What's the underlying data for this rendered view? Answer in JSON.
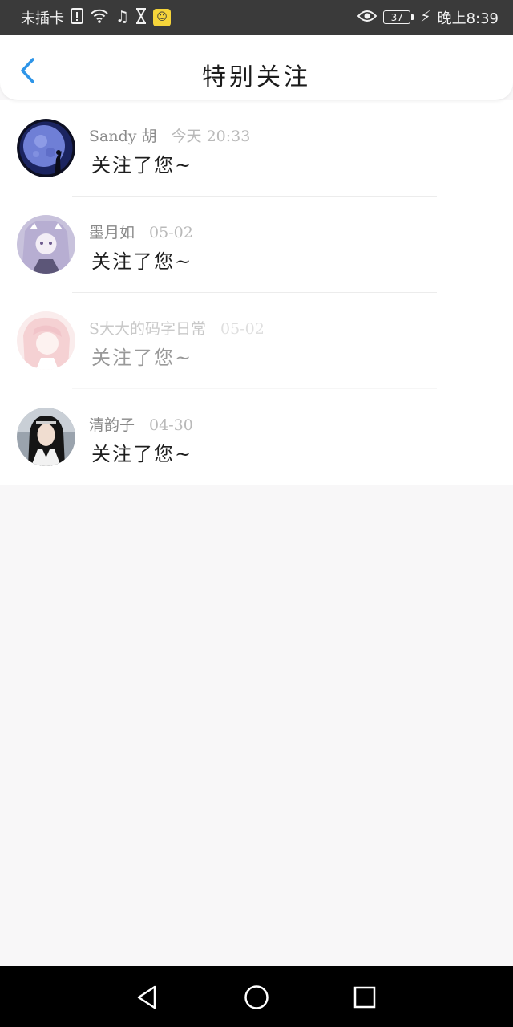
{
  "status_bar": {
    "sim_text": "未插卡",
    "battery_level": "37",
    "time": "晚上8:39",
    "icons": [
      "sim-alert-icon",
      "wifi-icon",
      "music-note-icon",
      "hourglass-icon",
      "app-notification-icon",
      "eye-care-icon",
      "battery-icon",
      "charging-bolt-icon"
    ]
  },
  "header": {
    "title": "特别关注",
    "back_icon": "chevron-left-icon",
    "accent_color": "#2e95e8"
  },
  "list": {
    "items": [
      {
        "name": "Sandy 胡",
        "time": "今天 20:33",
        "message": "关注了您~",
        "avatar": "moon-silhouette-avatar"
      },
      {
        "name": "墨月如",
        "time": "05-02",
        "message": "关注了您~",
        "avatar": "anime-girl-avatar"
      },
      {
        "name": "S大大的码字日常",
        "time": "05-02",
        "message": "关注了您~",
        "avatar": "pink-hair-avatar",
        "dimmed": true
      },
      {
        "name": "清韵子",
        "time": "04-30",
        "message": "关注了您~",
        "avatar": "costume-portrait-avatar"
      }
    ]
  },
  "nav_bar": {
    "buttons": [
      "back-triangle-icon",
      "home-circle-icon",
      "recents-square-icon"
    ]
  }
}
